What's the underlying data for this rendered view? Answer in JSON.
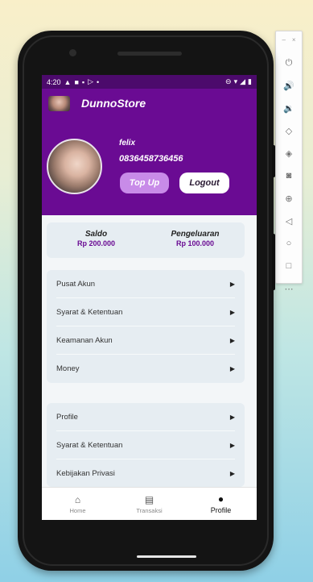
{
  "status_bar": {
    "time": "4:20"
  },
  "app": {
    "title": "DunnoStore"
  },
  "profile": {
    "name": "felix",
    "phone": "0836458736456",
    "topup_label": "Top Up",
    "logout_label": "Logout"
  },
  "balance": {
    "saldo_label": "Saldo",
    "saldo_value": "Rp 200.000",
    "pengeluaran_label": "Pengeluaran",
    "pengeluaran_value": "Rp 100.000"
  },
  "menu1": [
    {
      "label": "Pusat Akun"
    },
    {
      "label": "Syarat & Ketentuan"
    },
    {
      "label": "Keamanan Akun"
    },
    {
      "label": "Money"
    }
  ],
  "menu2": [
    {
      "label": "Profile"
    },
    {
      "label": "Syarat & Ketentuan"
    },
    {
      "label": "Kebijakan Privasi"
    }
  ],
  "bottom_nav": [
    {
      "label": "Home",
      "icon": "home-icon"
    },
    {
      "label": "Transaksi",
      "icon": "receipt-icon"
    },
    {
      "label": "Profile",
      "icon": "person-icon",
      "active": true
    }
  ],
  "colors": {
    "primary": "#6a0b93",
    "topup": "#c88be8",
    "card": "#e6edf2"
  }
}
